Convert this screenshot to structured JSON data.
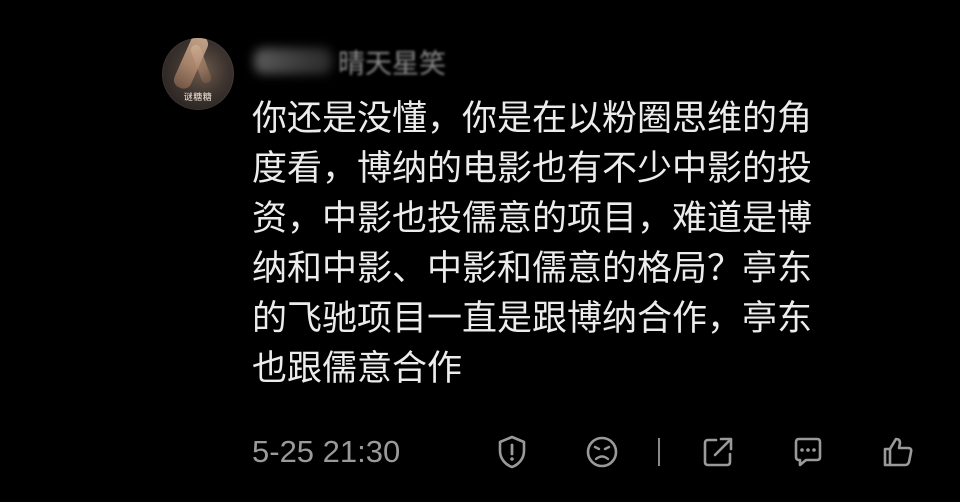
{
  "comment": {
    "username": "晴天星笑",
    "avatar_caption": "谜糖糖",
    "content": "你还是没懂，你是在以粉圈思维的角\n度看，博纳的电影也有不少中影的投\n资，中影也投儒意的项目，难道是博\n纳和中影、中影和儒意的格局？亭东\n的飞驰项目一直是跟博纳合作，亭东\n也跟儒意合作",
    "timestamp": "5-25 21:30"
  },
  "actions": [
    {
      "icon": "report-icon"
    },
    {
      "icon": "dislike-icon"
    },
    {
      "icon": "share-icon"
    },
    {
      "icon": "reply-icon"
    },
    {
      "icon": "like-icon"
    }
  ],
  "colors": {
    "background": "#000000",
    "text": "#ececec",
    "muted": "#9a9a9a"
  }
}
